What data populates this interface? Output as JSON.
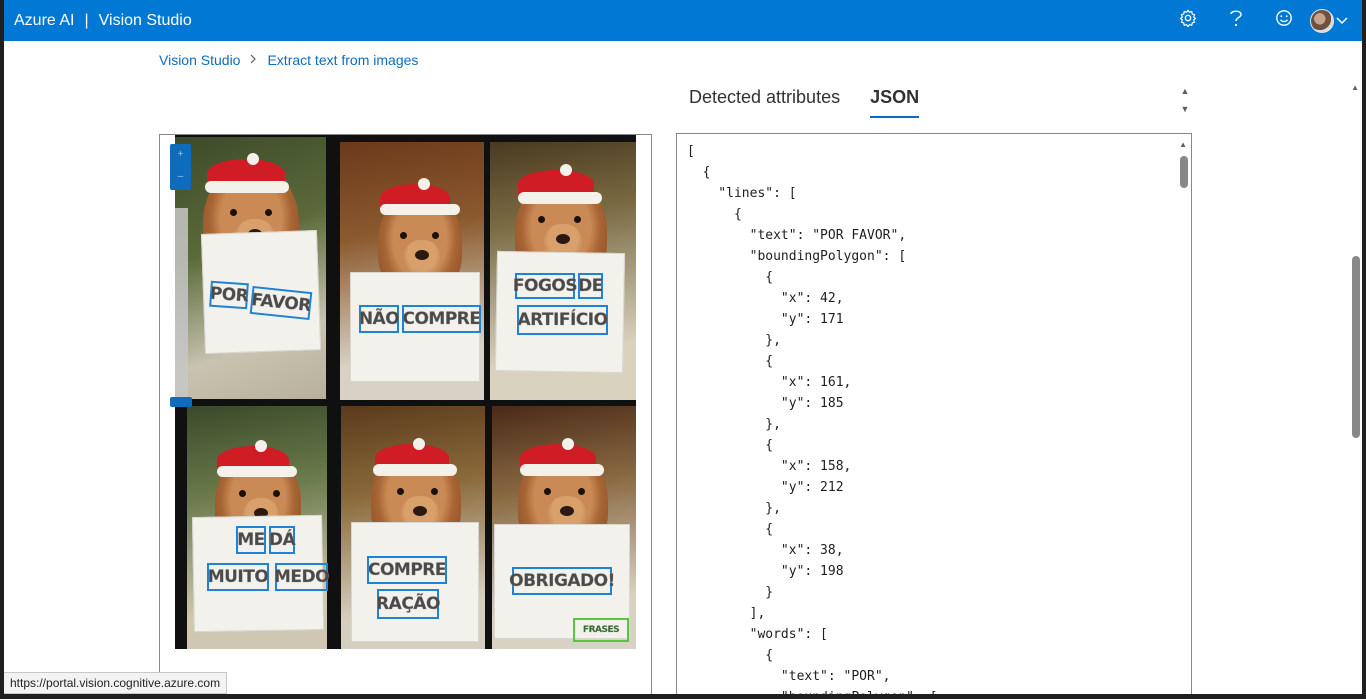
{
  "header": {
    "brand": "Azure AI",
    "separator": "|",
    "product": "Vision Studio",
    "icons": [
      "gear-icon",
      "help-icon",
      "smiley-icon",
      "avatar",
      "chevron-down-icon"
    ]
  },
  "breadcrumb": {
    "root": "Vision Studio",
    "current": "Extract text from images"
  },
  "tabs": {
    "detected": "Detected attributes",
    "json": "JSON",
    "active": "JSON"
  },
  "image": {
    "words": [
      "POR",
      "FAVOR",
      "NÃO",
      "COMPRE",
      "FOGOS",
      "DE",
      "ARTIFÍCIO",
      "ME",
      "DÁ",
      "MUITO",
      "MEDO",
      "COMPRE",
      "RAÇÃO",
      "OBRIGADO!",
      "FRASES"
    ]
  },
  "json_lines": [
    "[",
    "  {",
    "    \"lines\": [",
    "      {",
    "        \"text\": \"POR FAVOR\",",
    "        \"boundingPolygon\": [",
    "          {",
    "            \"x\": 42,",
    "            \"y\": 171",
    "          },",
    "          {",
    "            \"x\": 161,",
    "            \"y\": 185",
    "          },",
    "          {",
    "            \"x\": 158,",
    "            \"y\": 212",
    "          },",
    "          {",
    "            \"x\": 38,",
    "            \"y\": 198",
    "          }",
    "        ],",
    "        \"words\": [",
    "          {",
    "            \"text\": \"POR\",",
    "            \"boundingPolygon\": ["
  ],
  "status_url": "https://portal.vision.cognitive.azure.com",
  "colors": {
    "accent": "#0078d4",
    "link": "#0f6cbd",
    "ocr_box": "#1e82d6"
  }
}
